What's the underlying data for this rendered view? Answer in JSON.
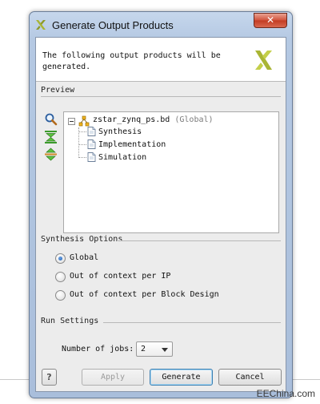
{
  "window": {
    "title": "Generate Output Products",
    "close_glyph": "✕"
  },
  "header": {
    "message_line1": "The following output products will be",
    "message_line2": "generated."
  },
  "preview": {
    "section_label": "Preview",
    "toolbar": [
      "search-icon",
      "collapse-all-icon",
      "expand-all-icon"
    ],
    "root": {
      "name": "zstar_zynq_ps.bd",
      "note": "(Global)"
    },
    "children": [
      "Synthesis",
      "Implementation",
      "Simulation"
    ]
  },
  "synthesis_options": {
    "section_label": "Synthesis Options",
    "options": [
      {
        "label": "Global",
        "checked": true
      },
      {
        "label": "Out of context per IP",
        "checked": false
      },
      {
        "label": "Out of context per Block Design",
        "checked": false
      }
    ]
  },
  "run_settings": {
    "section_label": "Run Settings",
    "jobs_label": "Number of jobs:",
    "jobs_value": "2"
  },
  "buttons": {
    "help": "?",
    "apply": "Apply",
    "generate": "Generate",
    "cancel": "Cancel"
  },
  "watermark": "EEChina.com",
  "colors": {
    "xilinx_logo": "#a9b534",
    "title_gradient": "#b5c9e3",
    "close_button": "#c94a32",
    "default_button_border": "#3c7fb1"
  }
}
